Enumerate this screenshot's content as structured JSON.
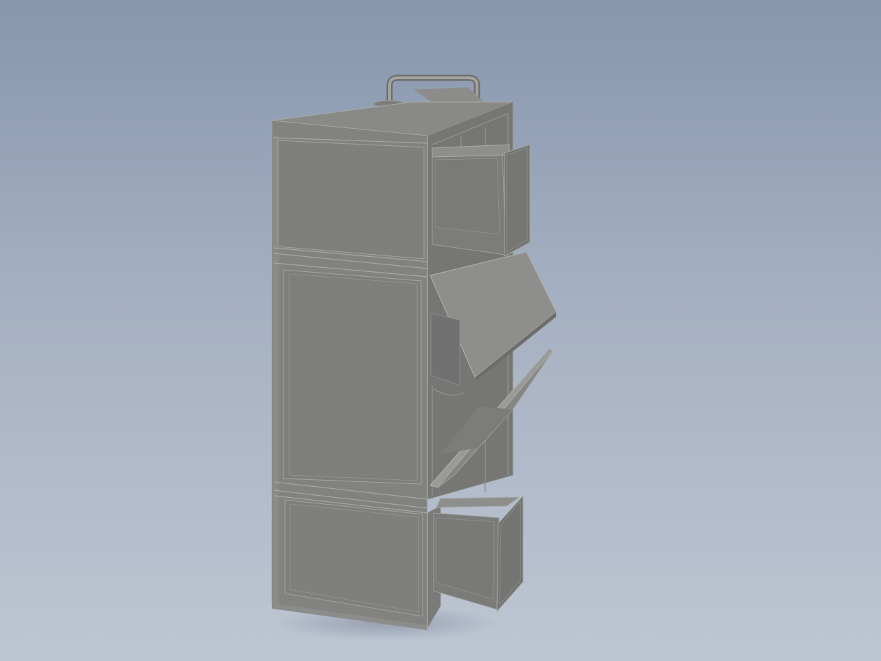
{
  "scene": {
    "background_top": "#8796ad",
    "background_bottom": "#bec6d2",
    "shadow_color": "#8a94a8"
  },
  "model": {
    "colors": {
      "front": "#828380",
      "front_inner": "#7e7f7c",
      "side": "#767774",
      "top": "#898a87",
      "edge": "#b9bab6",
      "dark": "#5e5f5c",
      "handle": "#9c9d9a",
      "panel_light": "#8e8f8c"
    },
    "parts": {
      "handle": "carry-handle",
      "drawers_open": 2,
      "flaps_open": 2
    }
  }
}
